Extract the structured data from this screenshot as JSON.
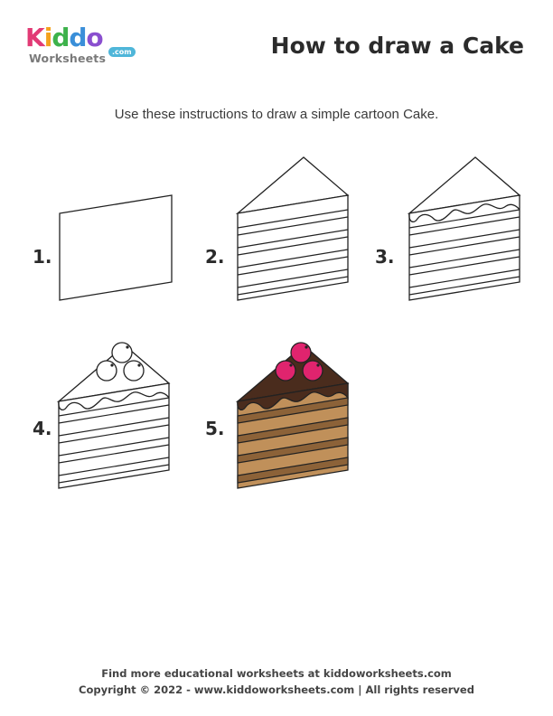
{
  "logo": {
    "letters": [
      "K",
      "i",
      "d",
      "d",
      "o"
    ],
    "letter_colors": [
      "#e23a75",
      "#f4a21d",
      "#3db24b",
      "#3a8fd9",
      "#8a4fcf"
    ],
    "sub": "Worksheets",
    "com": ".com"
  },
  "title": "How to draw a Cake",
  "subtitle": "Use these instructions to draw a simple cartoon Cake.",
  "steps": [
    {
      "label": "1."
    },
    {
      "label": "2."
    },
    {
      "label": "3."
    },
    {
      "label": "4."
    },
    {
      "label": "5."
    }
  ],
  "colors": {
    "outline": "#222222",
    "chocolate": "#4a2c1d",
    "cake": "#c0905a",
    "cake_dark": "#8c6238",
    "cherry": "#e0246e"
  },
  "footer": {
    "line1": "Find more educational worksheets at kiddoworksheets.com",
    "line2": "Copyright © 2022 - www.kiddoworksheets.com  |  All rights reserved"
  }
}
